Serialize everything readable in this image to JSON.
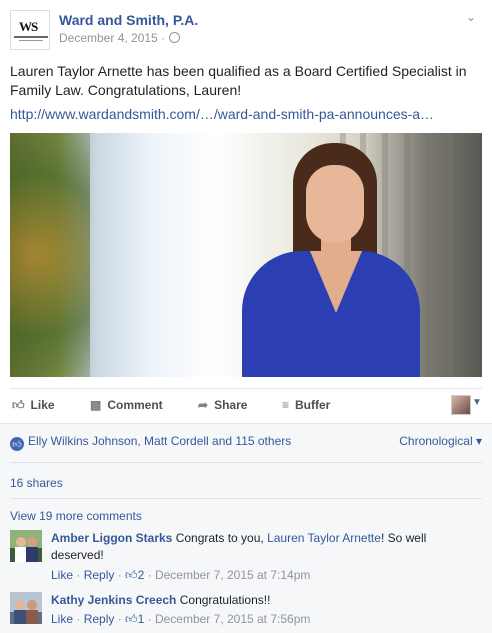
{
  "post": {
    "page_name": "Ward and Smith, P.A.",
    "date": "December 4, 2015 ·",
    "text": "Lauren Taylor Arnette has been qualified as a Board Certified Specialist in Family Law. Congratulations, Lauren!",
    "link": "http://www.wardandsmith.com/…/ward-and-smith-pa-announces-a…",
    "logo_mark": "WS"
  },
  "actions": {
    "like": "Like",
    "comment": "Comment",
    "share": "Share",
    "buffer": "Buffer"
  },
  "feedback": {
    "likers": "Elly Wilkins Johnson, Matt Cordell and 115 others",
    "sort": "Chronological",
    "shares": "16 shares",
    "more_comments": "View 19 more comments"
  },
  "comments": [
    {
      "author": "Amber Liggon Starks",
      "text_before": " Congrats to you, ",
      "mention": "Lauren Taylor Arnette",
      "text_after": "! So well deserved!",
      "like": "Like",
      "reply": "Reply",
      "likes": "2",
      "time": "December 7, 2015 at 7:14pm"
    },
    {
      "author": "Kathy Jenkins Creech",
      "text_before": " Congratulations!!",
      "mention": "",
      "text_after": "",
      "like": "Like",
      "reply": "Reply",
      "likes": "1",
      "time": "December 7, 2015 at 7:56pm"
    }
  ],
  "icons": {
    "like": "thumbs-up-icon",
    "comment": "speech-bubble-icon",
    "share": "share-arrow-icon",
    "buffer": "buffer-stack-icon",
    "globe": "globe-icon"
  },
  "colors": {
    "link": "#365899",
    "meta": "#90949c",
    "feedback_bg": "#f6f7f9",
    "dress": "#2b3fb3"
  }
}
